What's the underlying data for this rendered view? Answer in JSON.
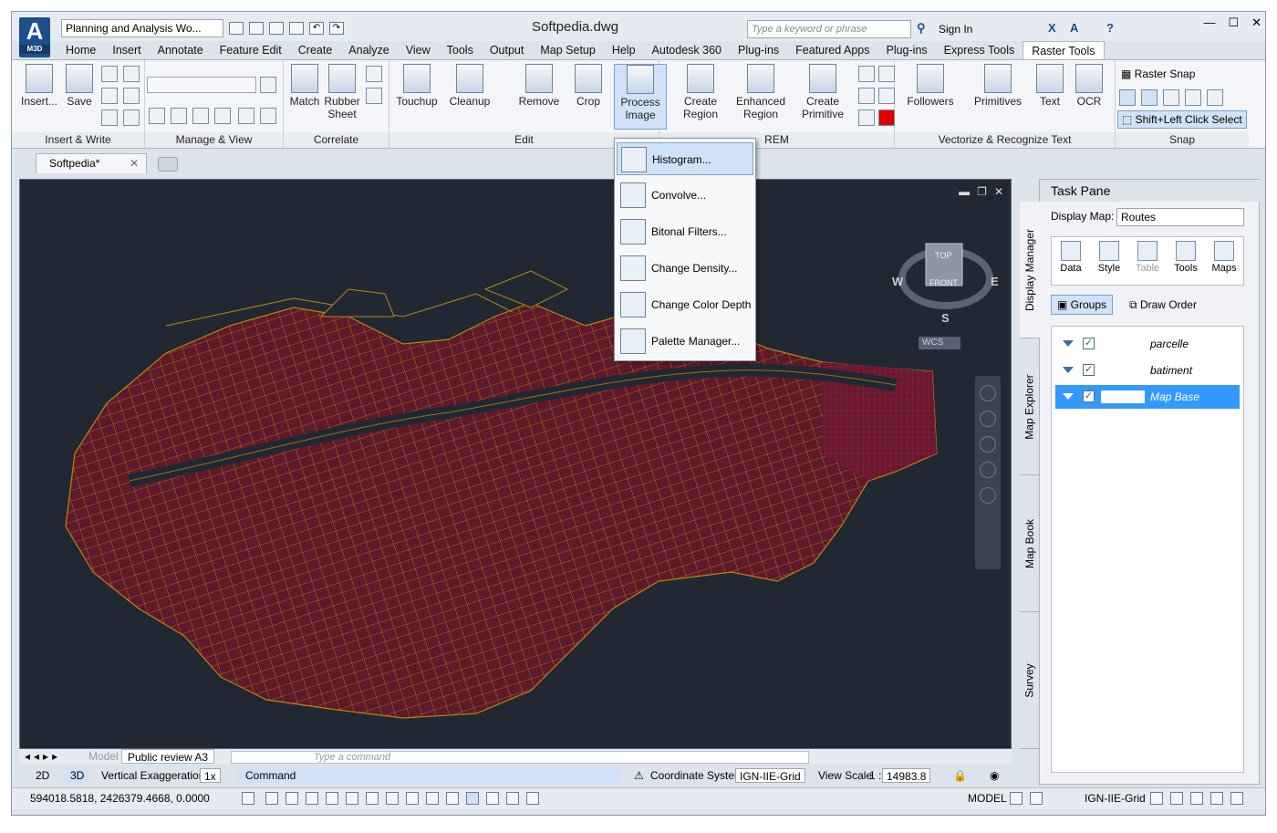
{
  "window": {
    "app_logo": "M3D",
    "workspace": "Planning and Analysis Wo...",
    "document_title": "Softpedia.dwg",
    "search_placeholder": "Type a keyword or phrase",
    "sign_in": "Sign In"
  },
  "menu": [
    "Home",
    "Insert",
    "Annotate",
    "Feature Edit",
    "Create",
    "Analyze",
    "View",
    "Tools",
    "Output",
    "Map Setup",
    "Help",
    "Autodesk 360",
    "Plug-ins",
    "Featured Apps",
    "Plug-ins",
    "Express Tools",
    "Raster Tools"
  ],
  "menu_active": "Raster Tools",
  "ribbon": {
    "insert_label": "Insert...",
    "save_label": "Save",
    "panel_insert_write": "Insert & Write",
    "panel_manage_view": "Manage & View",
    "match_label": "Match",
    "rubber_sheet_label": "Rubber Sheet",
    "panel_correlate": "Correlate",
    "touchup_label": "Touchup",
    "cleanup_label": "Cleanup",
    "remove_label": "Remove",
    "crop_label": "Crop",
    "process_image_label": "Process Image",
    "panel_edit": "Edit",
    "create_region_label": "Create Region",
    "enhanced_region_label": "Enhanced Region",
    "create_primitive_label": "Create Primitive",
    "panel_rem": "REM",
    "followers_label": "Followers",
    "primitives_label": "Primitives",
    "text_label": "Text",
    "ocr_label": "OCR",
    "panel_vectorize": "Vectorize & Recognize Text",
    "raster_snap_label": "Raster Snap",
    "shift_click_label": "Shift+Left Click Select",
    "panel_snap": "Snap"
  },
  "process_menu": [
    "Histogram...",
    "Convolve...",
    "Bitonal Filters...",
    "Change Density...",
    "Change Color Depth",
    "Palette Manager..."
  ],
  "doc_tab": "Softpedia*",
  "viewcube": {
    "top": "TOP",
    "front": "FRONT",
    "w": "W",
    "e": "E",
    "s": "S",
    "wcs": "WCS"
  },
  "layout_tabs": {
    "model": "Model",
    "layout": "Public review A3"
  },
  "command_placeholder": "Type a command",
  "status": {
    "mode_2d": "2D",
    "mode_3d": "3D",
    "vert_exag_label": "Vertical Exaggeration:",
    "vert_exag_value": "1x",
    "command": "Command",
    "coord_sys_label": "Coordinate System:",
    "coord_sys_value": "IGN-IIE-Grid",
    "view_scale_label": "View Scale",
    "view_scale_num": "1 :",
    "view_scale_value": "14983.8"
  },
  "coords": "594018.5818, 2426379.4668, 0.0000",
  "coordbar": {
    "model": "MODEL",
    "grid": "IGN-IIE-Grid"
  },
  "taskpane": {
    "title": "Task Pane",
    "display_map_label": "Display Map:",
    "display_map_value": "Routes",
    "tools": [
      "Data",
      "Style",
      "Table",
      "Tools",
      "Maps"
    ],
    "groups_label": "Groups",
    "draw_order_label": "Draw Order",
    "layers": [
      {
        "name": "parcelle",
        "checked": "✓"
      },
      {
        "name": "batiment",
        "checked": "✓"
      },
      {
        "name": "Map Base",
        "checked": "✓"
      }
    ],
    "side_tabs": [
      "Display Manager",
      "Map Explorer",
      "Map Book",
      "Survey"
    ]
  },
  "colors": {
    "map_bg": "#212834",
    "parcel_line": "#b8860b",
    "building_fill": "#7a1530",
    "accent": "#3399ff"
  }
}
